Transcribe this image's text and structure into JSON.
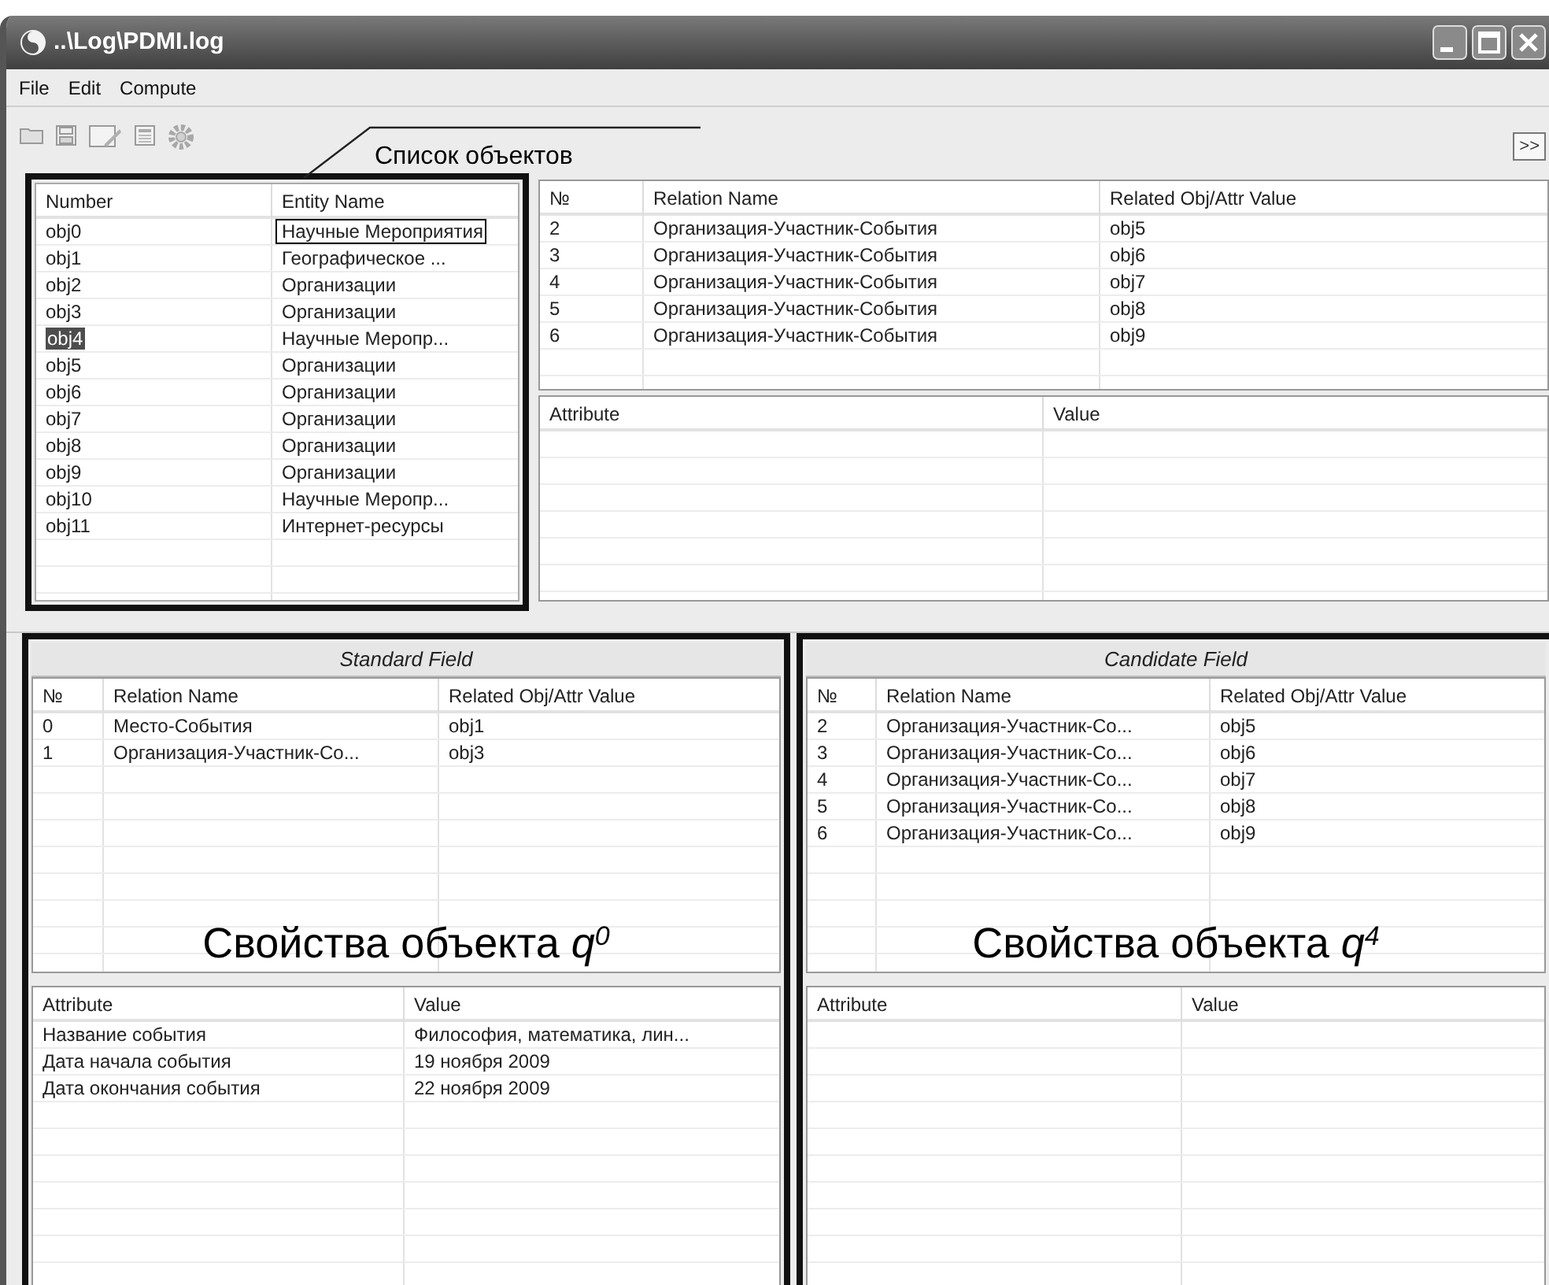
{
  "window": {
    "title": "..\\Log\\PDMI.log"
  },
  "menu": [
    {
      "label": "File"
    },
    {
      "label": "Edit"
    },
    {
      "label": "Compute"
    }
  ],
  "toolbar": {
    "expand_button": ">>"
  },
  "objects_list": {
    "callout": "Список объектов",
    "columns": [
      "Number",
      "Entity Name"
    ],
    "rows": [
      {
        "number": "obj0",
        "entity": "Научные Мероприятия",
        "selected": false,
        "focused": true
      },
      {
        "number": "obj1",
        "entity": "Географическое ...",
        "selected": false,
        "focused": false
      },
      {
        "number": "obj2",
        "entity": "Организации",
        "selected": false,
        "focused": false
      },
      {
        "number": "obj3",
        "entity": "Организации",
        "selected": false,
        "focused": false
      },
      {
        "number": "obj4",
        "entity": "Научные Меропр...",
        "selected": true,
        "focused": false
      },
      {
        "number": "obj5",
        "entity": "Организации",
        "selected": false,
        "focused": false
      },
      {
        "number": "obj6",
        "entity": "Организации",
        "selected": false,
        "focused": false
      },
      {
        "number": "obj7",
        "entity": "Организации",
        "selected": false,
        "focused": false
      },
      {
        "number": "obj8",
        "entity": "Организации",
        "selected": false,
        "focused": false
      },
      {
        "number": "obj9",
        "entity": "Организации",
        "selected": false,
        "focused": false
      },
      {
        "number": "obj10",
        "entity": "Научные Меропр...",
        "selected": false,
        "focused": false
      },
      {
        "number": "obj11",
        "entity": "Интернет-ресурсы",
        "selected": false,
        "focused": false
      }
    ]
  },
  "relations": {
    "columns": [
      "№",
      "Relation Name",
      "Related Obj/Attr Value"
    ],
    "rows": [
      [
        "2",
        "Организация-Участник-События",
        "obj5"
      ],
      [
        "3",
        "Организация-Участник-События",
        "obj6"
      ],
      [
        "4",
        "Организация-Участник-События",
        "obj7"
      ],
      [
        "5",
        "Организация-Участник-События",
        "obj8"
      ],
      [
        "6",
        "Организация-Участник-События",
        "obj9"
      ]
    ]
  },
  "attributes": {
    "columns": [
      "Attribute",
      "Value"
    ]
  },
  "standard_field": {
    "title": "Standard Field",
    "relations": {
      "columns": [
        "№",
        "Relation Name",
        "Related Obj/Attr Value"
      ],
      "rows": [
        [
          "0",
          "Место-События",
          "obj1"
        ],
        [
          "1",
          "Организация-Участник-Со...",
          "obj3"
        ]
      ]
    },
    "caption": "Свойства объекта *q*$^{0}$",
    "attributes": {
      "columns": [
        "Attribute",
        "Value"
      ],
      "rows": [
        [
          "Название события",
          "Философия, математика, лин..."
        ],
        [
          "Дата начала события",
          "19 ноября 2009"
        ],
        [
          "Дата окончания события",
          "22 ноября 2009"
        ]
      ]
    }
  },
  "candidate_field": {
    "title": "Candidate Field",
    "relations": {
      "columns": [
        "№",
        "Relation Name",
        "Related Obj/Attr Value"
      ],
      "rows": [
        [
          "2",
          "Организация-Участник-Со...",
          "obj5"
        ],
        [
          "3",
          "Организация-Участник-Со...",
          "obj6"
        ],
        [
          "4",
          "Организация-Участник-Со...",
          "obj7"
        ],
        [
          "5",
          "Организация-Участник-Со...",
          "obj8"
        ],
        [
          "6",
          "Организация-Участник-Со...",
          "obj9"
        ]
      ]
    },
    "caption": "Свойства объекта *q*$^{4}$",
    "attributes": {
      "columns": [
        "Attribute",
        "Value"
      ]
    }
  }
}
